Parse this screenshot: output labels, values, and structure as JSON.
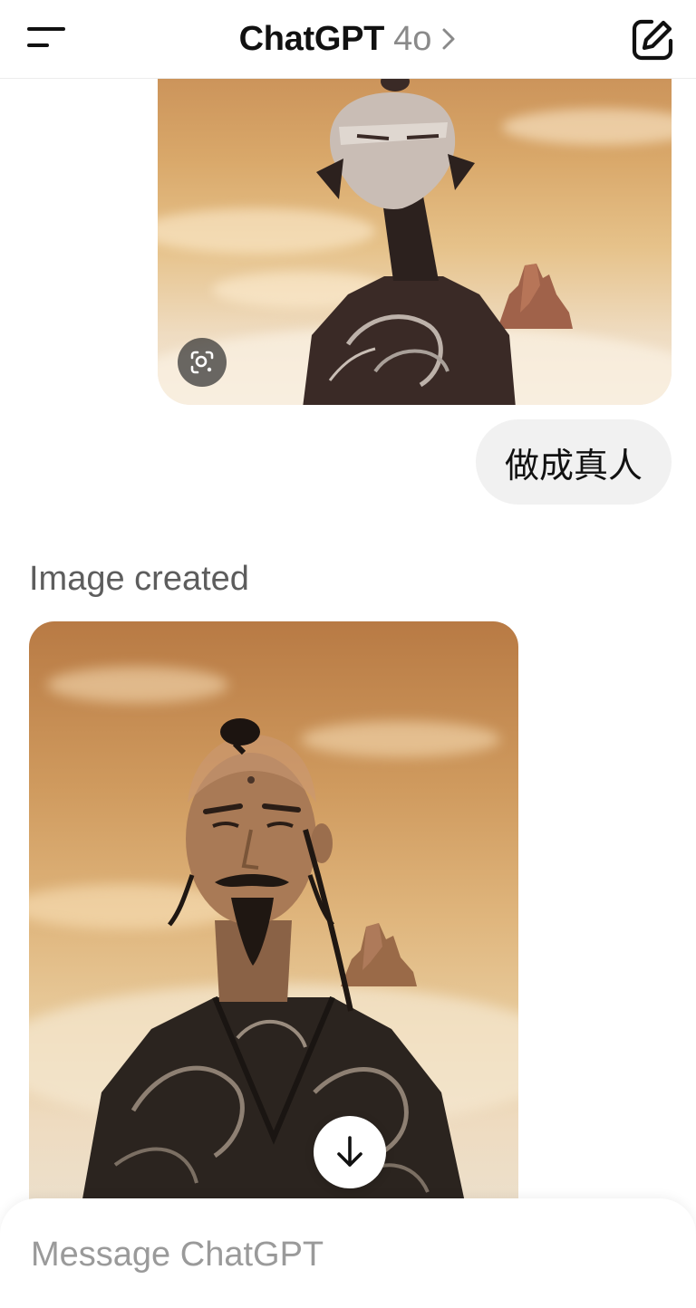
{
  "header": {
    "title": "ChatGPT",
    "model": "4o",
    "menu_icon": "menu-icon",
    "chevron_icon": "chevron-right-icon",
    "new_chat_icon": "new-chat-icon"
  },
  "conversation": {
    "user_image": {
      "lens_icon": "visual-search-icon"
    },
    "user_message": "做成真人",
    "assistant": {
      "status": "Image created",
      "download_icon": "arrow-down-icon"
    }
  },
  "composer": {
    "placeholder": "Message ChatGPT"
  }
}
